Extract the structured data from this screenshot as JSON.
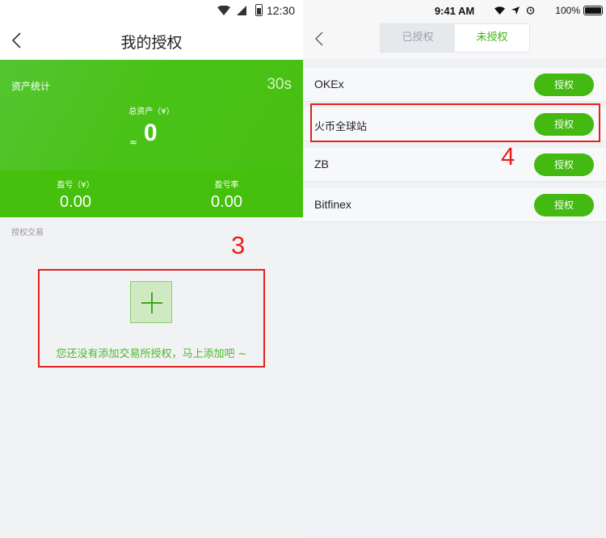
{
  "left": {
    "status": {
      "time": "12:30"
    },
    "nav": {
      "title": "我的授权"
    },
    "card": {
      "asset_stats_label": "资产统计",
      "timer": "30s",
      "total_label": "总资产（¥）",
      "approx_symbol": "≈",
      "total_value": "0",
      "pl_label": "盈亏（¥）",
      "pl_value": "0.00",
      "pl_rate_label": "盈亏率",
      "pl_rate_value": "0.00"
    },
    "section_label": "授权交易",
    "annotation": "3",
    "empty_message": "您还没有添加交易所授权，马上添加吧 ~"
  },
  "right": {
    "status": {
      "time": "9:41 AM",
      "battery": "100%"
    },
    "segments": {
      "authorized": "已授权",
      "unauthorized": "未授权",
      "active": "unauthorized"
    },
    "exchanges": [
      {
        "name": "OKEx",
        "button": "授权"
      },
      {
        "name": "火币全球站",
        "button": "授权"
      },
      {
        "name": "ZB",
        "button": "授权"
      },
      {
        "name": "Bitfinex",
        "button": "授权"
      }
    ],
    "annotation": "4"
  },
  "colors": {
    "brand_green": "#47c011",
    "annotation_red": "#e32020",
    "link_green": "#4ab82a"
  }
}
